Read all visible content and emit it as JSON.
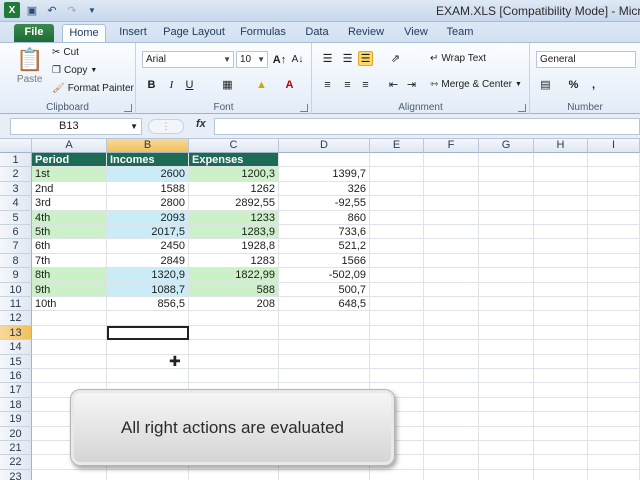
{
  "window": {
    "title": "EXAM.XLS  [Compatibility Mode] - Microso"
  },
  "tabs": [
    "File",
    "Home",
    "Insert",
    "Page Layout",
    "Formulas",
    "Data",
    "Review",
    "View",
    "Team"
  ],
  "ribbon": {
    "clipboard": {
      "label": "Clipboard",
      "paste": "Paste",
      "cut": "Cut",
      "copy": "Copy",
      "format_painter": "Format Painter"
    },
    "font": {
      "label": "Font",
      "name": "Arial",
      "size": "10",
      "bold": "B",
      "italic": "I",
      "underline": "U"
    },
    "alignment": {
      "label": "Alignment",
      "wrap_text": "Wrap Text",
      "merge_center": "Merge & Center"
    },
    "number": {
      "label": "Number",
      "format": "General",
      "percent": "%"
    }
  },
  "formula_bar": {
    "name_box": "B13",
    "fx": "fx",
    "value": ""
  },
  "grid": {
    "columns": [
      "A",
      "B",
      "C",
      "D",
      "E",
      "F",
      "G",
      "H",
      "I"
    ],
    "selected_column": "B",
    "selected_row": "13",
    "row_numbers": [
      "1",
      "2",
      "3",
      "4",
      "5",
      "6",
      "7",
      "8",
      "9",
      "10",
      "11",
      "12",
      "13",
      "14",
      "15",
      "16",
      "17",
      "18",
      "19",
      "20",
      "21",
      "22",
      "23"
    ],
    "headers": [
      "Period",
      "Incomes",
      "Expenses"
    ],
    "rows": [
      [
        "1st",
        "2600",
        "1200,3",
        "1399,7"
      ],
      [
        "2nd",
        "1588",
        "1262",
        "326"
      ],
      [
        "3rd",
        "2800",
        "2892,55",
        "-92,55"
      ],
      [
        "4th",
        "2093",
        "1233",
        "860"
      ],
      [
        "5th",
        "2017,5",
        "1283,9",
        "733,6"
      ],
      [
        "6th",
        "2450",
        "1928,8",
        "521,2"
      ],
      [
        "7th",
        "2849",
        "1283",
        "1566"
      ],
      [
        "8th",
        "1320,9",
        "1822,99",
        "-502,09"
      ],
      [
        "9th",
        "1088,7",
        "588",
        "500,7"
      ],
      [
        "10th",
        "856,5",
        "208",
        "648,5"
      ]
    ]
  },
  "overlay": {
    "text": "All right actions are evaluated"
  }
}
